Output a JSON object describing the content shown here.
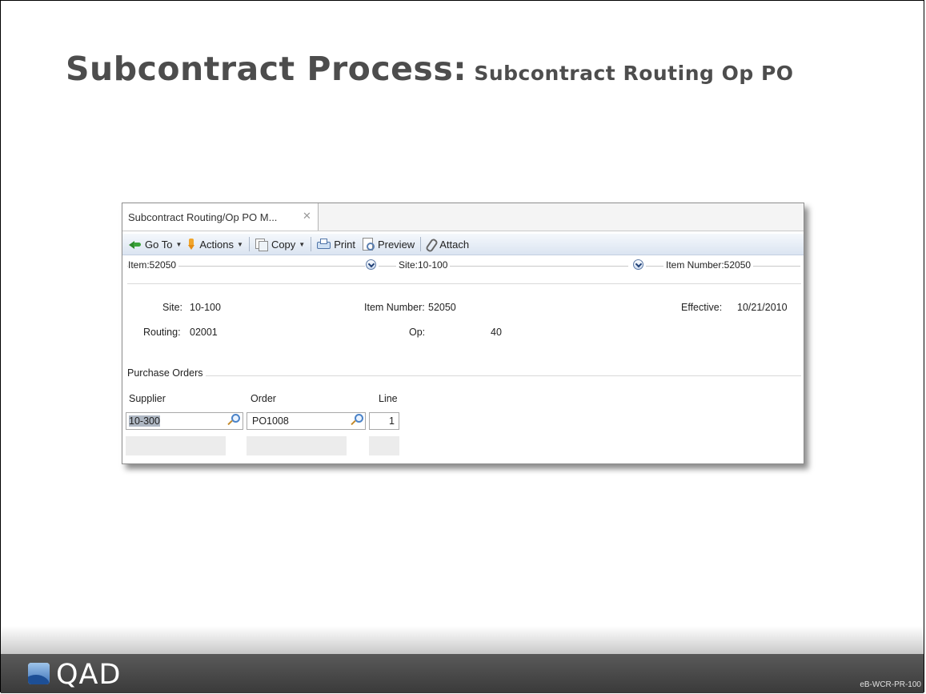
{
  "slide": {
    "title_main": "Subcontract Process:",
    "title_sub": " Subcontract Routing Op PO",
    "logo_text": "QAD",
    "doc_code": "eB-WCR-PR-100"
  },
  "window": {
    "tab_label": "Subcontract Routing/Op PO M...",
    "tab_close": "✕",
    "toolbar": {
      "goto": "Go To",
      "actions": "Actions",
      "copy": "Copy",
      "print": "Print",
      "preview": "Preview",
      "attach": "Attach",
      "caret": "▼"
    },
    "filters": {
      "item": "Item:52050",
      "site": "Site:10-100",
      "item_number": "Item Number:52050"
    },
    "header": {
      "site_label": "Site:",
      "site_value": "10-100",
      "item_number_label": "Item Number:",
      "item_number_value": "52050",
      "effective_label": "Effective:",
      "effective_value": "10/21/2010",
      "routing_label": "Routing:",
      "routing_value": "02001",
      "op_label": "Op:",
      "op_value": "40"
    },
    "purchase_orders": {
      "section_label": "Purchase Orders",
      "columns": [
        "Supplier",
        "Order",
        "Line"
      ],
      "rows": [
        {
          "supplier": "10-300",
          "order": "PO1008",
          "line": "1"
        }
      ]
    }
  }
}
